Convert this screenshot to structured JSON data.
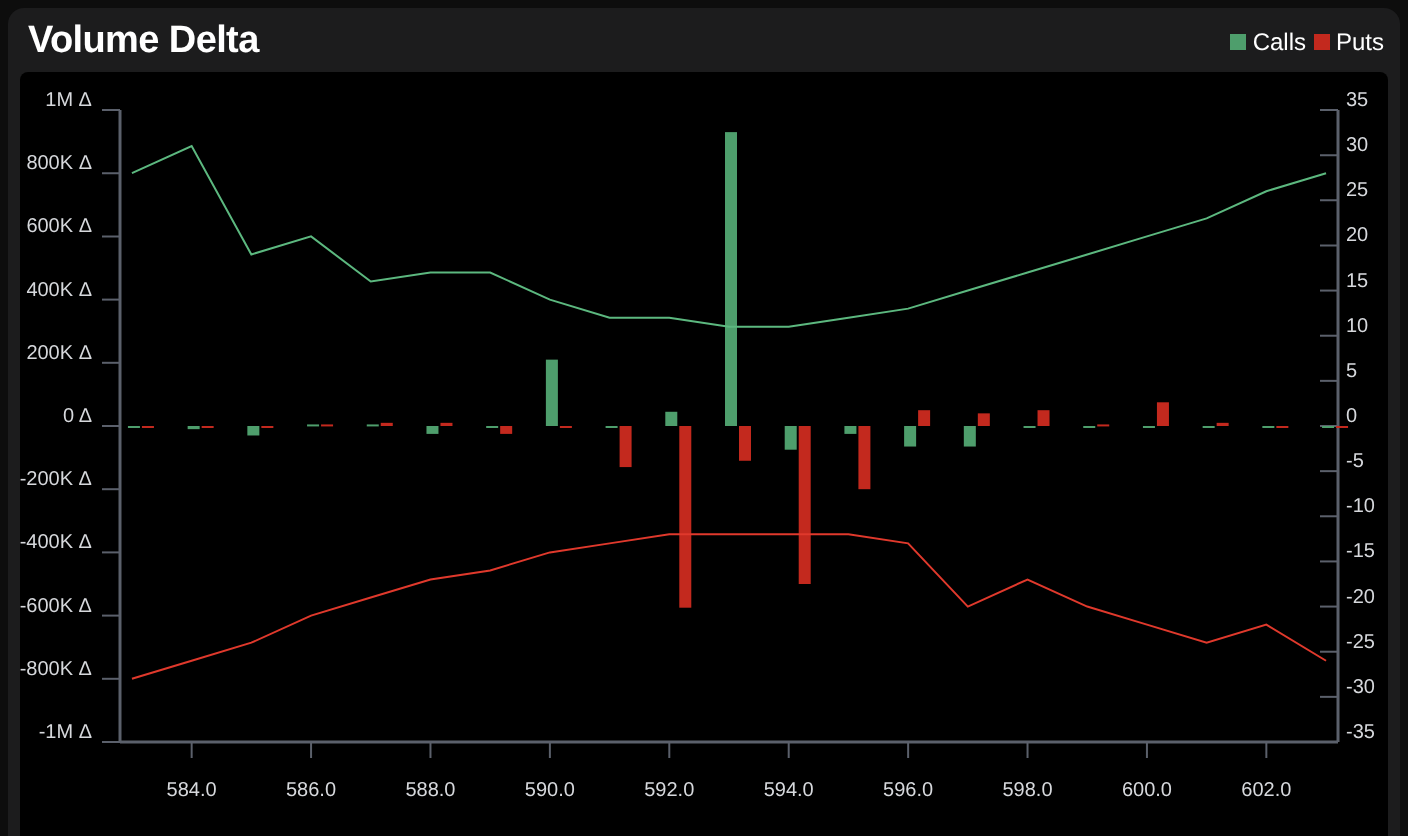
{
  "title": "Volume Delta",
  "chart_data": {
    "type": "bar",
    "x": [
      583,
      584,
      585,
      586,
      587,
      588,
      589,
      590,
      591,
      592,
      593,
      594,
      595,
      596,
      597,
      598,
      599,
      600,
      601,
      602,
      603
    ],
    "series": [
      {
        "name": "Calls",
        "color": "#4e9e6c",
        "values": [
          -3000,
          -10000,
          -30000,
          5000,
          5000,
          -25000,
          -5000,
          210000,
          0,
          45000,
          930000,
          -75000,
          -25000,
          -65000,
          -65000,
          0,
          -5000,
          0,
          -5000,
          -3000,
          0
        ]
      },
      {
        "name": "Puts",
        "color": "#c3291e",
        "values": [
          0,
          0,
          0,
          5000,
          10000,
          10000,
          -25000,
          -3000,
          -130000,
          -575000,
          -110000,
          -500000,
          -200000,
          50000,
          40000,
          50000,
          5000,
          75000,
          10000,
          0,
          0
        ]
      },
      {
        "type": "line",
        "axis": "y2",
        "color": "#5cb87f",
        "values": [
          28,
          31,
          19,
          21,
          16,
          17,
          17,
          14,
          12,
          12,
          11,
          11,
          12,
          13,
          15,
          17,
          19,
          21,
          23,
          26,
          28
        ]
      },
      {
        "type": "line",
        "axis": "y2",
        "color": "#e0392c",
        "values": [
          -28,
          -26,
          -24,
          -21,
          -19,
          -17,
          -16,
          -14,
          -13,
          -12,
          -12,
          -12,
          -12,
          -13,
          -20,
          -17,
          -20,
          -22,
          -24,
          -22,
          -26
        ]
      }
    ],
    "xlim": [
      582.8,
      603.2
    ],
    "xticks": [
      {
        "value": 584,
        "label": "584.0"
      },
      {
        "value": 586,
        "label": "586.0"
      },
      {
        "value": 588,
        "label": "588.0"
      },
      {
        "value": 590,
        "label": "590.0"
      },
      {
        "value": 592,
        "label": "592.0"
      },
      {
        "value": 594,
        "label": "594.0"
      },
      {
        "value": 596,
        "label": "596.0"
      },
      {
        "value": 598,
        "label": "598.0"
      },
      {
        "value": 600,
        "label": "600.0"
      },
      {
        "value": 602,
        "label": "602.0"
      }
    ],
    "ylim": [
      -1000000,
      1000000
    ],
    "yticks": [
      {
        "value": 1000000,
        "label": "1M Δ"
      },
      {
        "value": 800000,
        "label": "800K Δ"
      },
      {
        "value": 600000,
        "label": "600K Δ"
      },
      {
        "value": 400000,
        "label": "400K Δ"
      },
      {
        "value": 200000,
        "label": "200K Δ"
      },
      {
        "value": 0,
        "label": "0 Δ"
      },
      {
        "value": -200000,
        "label": "-200K Δ"
      },
      {
        "value": -400000,
        "label": "-400K Δ"
      },
      {
        "value": -600000,
        "label": "-600K Δ"
      },
      {
        "value": -800000,
        "label": "-800K Δ"
      },
      {
        "value": -1000000,
        "label": "-1M Δ"
      }
    ],
    "y2lim": [
      -35,
      35
    ],
    "y2ticks": [
      35,
      30,
      25,
      20,
      15,
      10,
      5,
      0,
      -5,
      -10,
      -15,
      -20,
      -25,
      -30,
      -35
    ]
  }
}
